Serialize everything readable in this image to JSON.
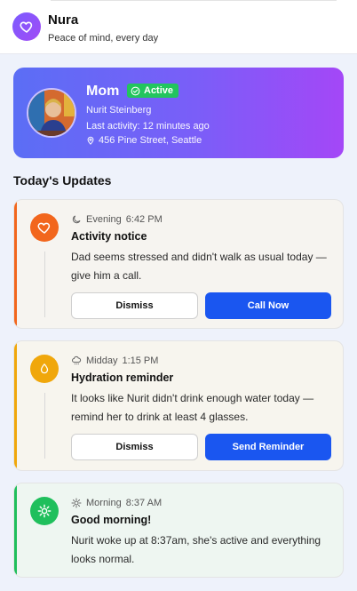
{
  "app": {
    "title": "Nura",
    "subtitle": "Peace of mind, every day",
    "logo_icon": "heart-icon",
    "brand_color": "#7b5cff"
  },
  "profile": {
    "name": "Mom",
    "status": "Active",
    "full_name": "Nurit Steinberg",
    "last_activity": "Last activity: 12 minutes ago",
    "address": "456 Pine Street, Seattle"
  },
  "updates": {
    "section_title": "Today's Updates",
    "items": [
      {
        "period": "Evening",
        "time": "6:42 PM",
        "period_icon": "moon-icon",
        "title": "Activity notice",
        "body": "Dad seems stressed and didn't walk as usual today — give him a call.",
        "icon": "heart-icon",
        "accent": "#f2661d",
        "secondary_label": "Dismiss",
        "primary_label": "Call Now"
      },
      {
        "period": "Midday",
        "time": "1:15 PM",
        "period_icon": "cloud-rain-icon",
        "title": "Hydration reminder",
        "body": "It looks like Nurit didn't drink enough water today — remind her to drink at least 4 glasses.",
        "icon": "water-drop-icon",
        "accent": "#f0a70b",
        "secondary_label": "Dismiss",
        "primary_label": "Send Reminder"
      },
      {
        "period": "Morning",
        "time": "8:37 AM",
        "period_icon": "sun-icon",
        "title": "Good morning!",
        "body": "Nurit woke up at 8:37am, she's active and everything looks normal.",
        "icon": "sun-icon",
        "accent": "#1fbf5c"
      }
    ]
  }
}
